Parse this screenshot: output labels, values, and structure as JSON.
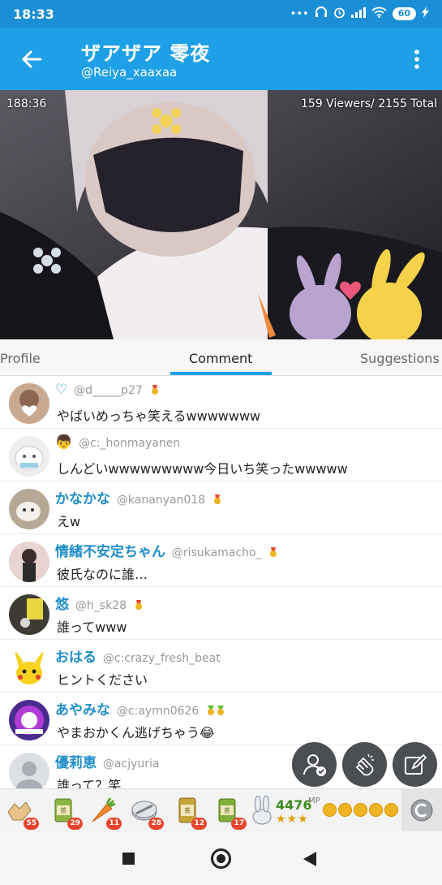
{
  "status_bar": {
    "time": "18:33",
    "battery": "60"
  },
  "header": {
    "title": "ザアザア 零夜",
    "handle": "@Reiya_xaaxaa"
  },
  "video": {
    "timer": "188:36",
    "viewers": "159 Viewers/ 2155 Total"
  },
  "tabs": [
    "Profile",
    "Comment",
    "Suggestions"
  ],
  "active_tab": "Comment",
  "comments": [
    {
      "name": "♡",
      "handle": "@d_____p27",
      "text": "やばいめっちゃ笑えるwwwwwww",
      "badge": "medal"
    },
    {
      "name": "👦",
      "handle": "@c:_honmayanen",
      "text": "しんどいwwwwwwwww今日いち笑ったwwwww",
      "badge": ""
    },
    {
      "name": "かなかな",
      "handle": "@kananyan018",
      "text": "えw",
      "badge": "medal"
    },
    {
      "name": "情緒不安定ちゃん",
      "handle": "@risukamacho_",
      "text": "彼氏なのに誰…",
      "badge": "medal"
    },
    {
      "name": "悠",
      "handle": "@h_sk28",
      "text": "誰ってwww",
      "badge": "medal"
    },
    {
      "name": "おはる",
      "handle": "@c:crazy_fresh_beat",
      "text": "ヒントください",
      "badge": ""
    },
    {
      "name": "あやみな",
      "handle": "@c:aymn0626",
      "text": "やまおかくん逃げちゃう😂",
      "badge": "double-medal"
    },
    {
      "name": "優莉恵",
      "handle": "@acjyuria",
      "text": "誰って？笑",
      "badge": ""
    }
  ],
  "gifts": [
    {
      "icon": "hand-gift-icon",
      "count": "55"
    },
    {
      "icon": "tea-50-icon",
      "count": "29"
    },
    {
      "icon": "carrot-icon",
      "count": "11"
    },
    {
      "icon": "coin-stack-icon",
      "count": "28"
    },
    {
      "icon": "tea-can-icon",
      "count": "12"
    },
    {
      "icon": "tea-10-icon",
      "count": "17"
    }
  ],
  "points": {
    "value": "4476",
    "unit": "MP",
    "stars": "★★★"
  },
  "colors": {
    "app_bar": "#1ea0e6",
    "status_bar": "#1a8fd6",
    "name_blue": "#1f8ec8",
    "fab": "#4b4e52"
  }
}
